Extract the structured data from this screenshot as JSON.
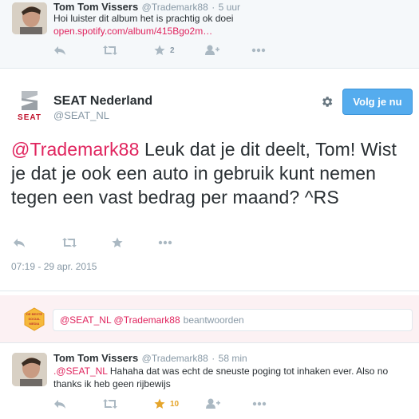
{
  "tweet1": {
    "name": "Tom Tom Vissers",
    "handle": "@Trademark88",
    "time": "5 uur",
    "text": "Hoi luister dit album het is prachtig ok doei",
    "link": "open.spotify.com/album/415Bgo2m…",
    "favorite_count": "2",
    "icons": [
      "reply-icon",
      "retweet-icon",
      "favorite-icon",
      "follow-icon",
      "more-icon"
    ]
  },
  "main_tweet": {
    "name": "SEAT Nederland",
    "handle": "@SEAT_NL",
    "logo_text": "SEAT",
    "follow_label": "Volg je nu",
    "mention": "@Trademark88",
    "text": " Leuk dat je dit deelt, Tom! Wist je dat je ook een auto in gebruik kunt nemen tegen een vast bedrag per maand? ^RS",
    "timestamp": "07:19 - 29 apr. 2015",
    "icons": [
      "reply-icon",
      "retweet-icon",
      "favorite-icon",
      "more-icon",
      "gear-icon"
    ]
  },
  "reply": {
    "badge_text": "DE BESTE SOCIAL MEDIA",
    "prefill": "@SEAT_NL @Trademark88",
    "placeholder": "beantwoorden"
  },
  "tweet3": {
    "name": "Tom Tom Vissers",
    "handle": "@Trademark88",
    "time": "58 min",
    "mention": ".@SEAT_NL",
    "text": " Hahaha dat was echt de sneuste poging tot inhaken ever. Also no thanks ik heb geen rijbewijs",
    "favorite_count": "10"
  },
  "colors": {
    "accent_link": "#e0245e",
    "follow_button": "#55acee",
    "favorite_active": "#e5a52b",
    "reply_bg": "#fcf1f3"
  }
}
